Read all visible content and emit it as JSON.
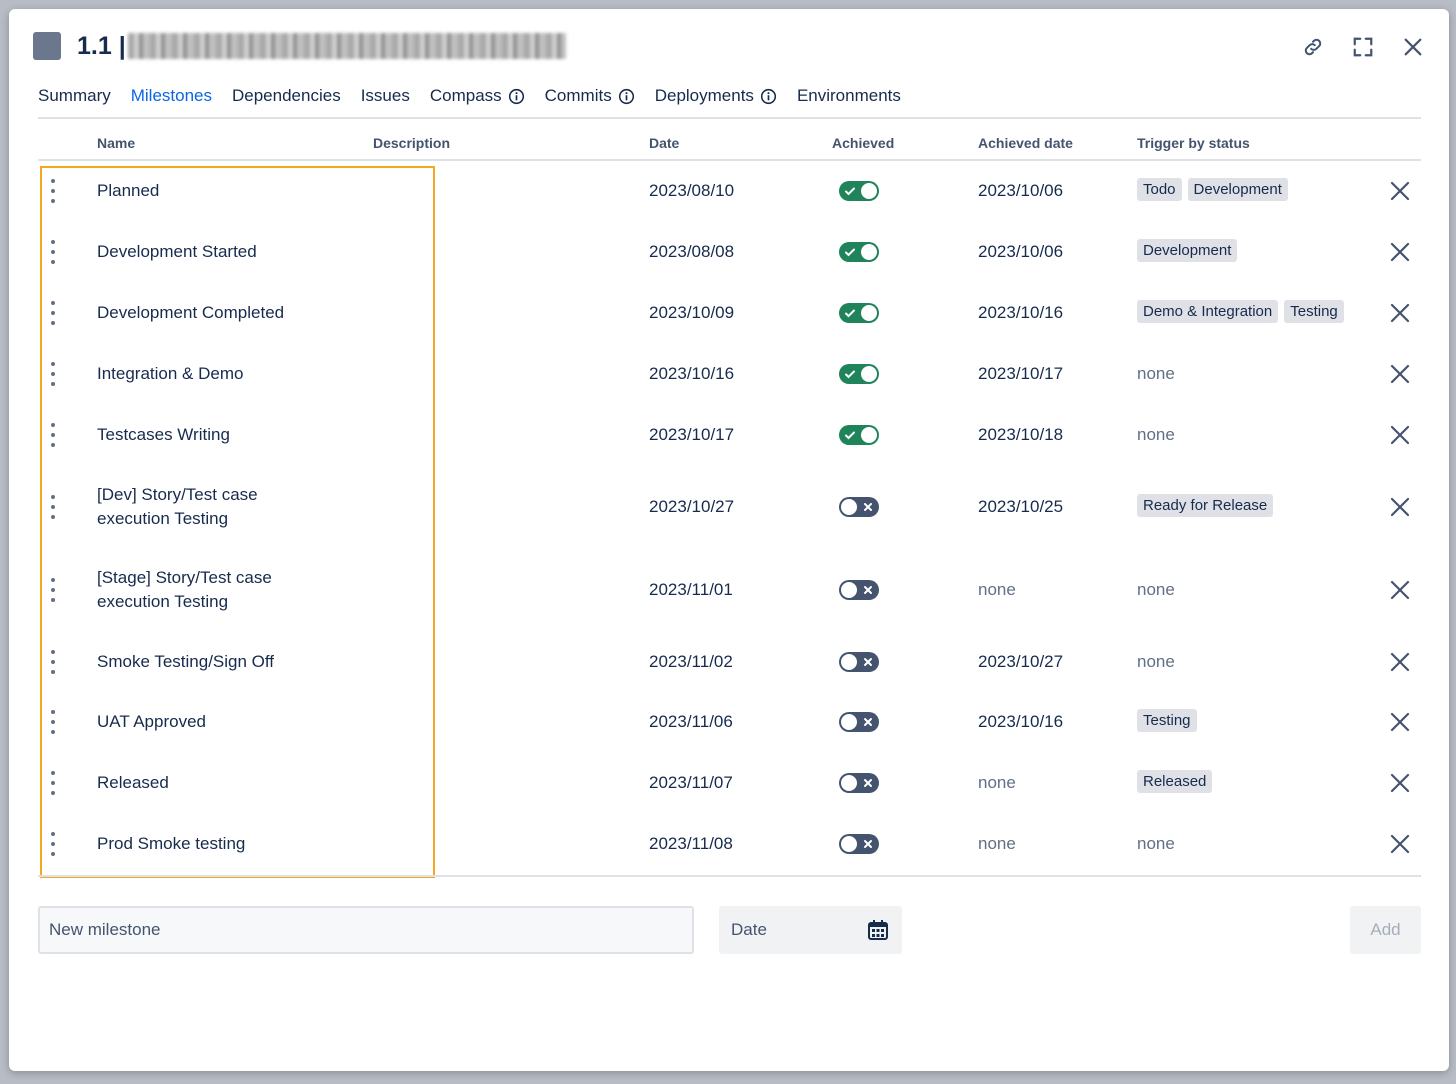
{
  "header": {
    "title_prefix": "1.1 |"
  },
  "tabs": [
    {
      "label": "Summary",
      "active": false,
      "info": false
    },
    {
      "label": "Milestones",
      "active": true,
      "info": false
    },
    {
      "label": "Dependencies",
      "active": false,
      "info": false
    },
    {
      "label": "Issues",
      "active": false,
      "info": false
    },
    {
      "label": "Compass",
      "active": false,
      "info": true
    },
    {
      "label": "Commits",
      "active": false,
      "info": true
    },
    {
      "label": "Deployments",
      "active": false,
      "info": true
    },
    {
      "label": "Environments",
      "active": false,
      "info": false
    }
  ],
  "columns": {
    "name": "Name",
    "description": "Description",
    "date": "Date",
    "achieved": "Achieved",
    "achieved_date": "Achieved date",
    "trigger": "Trigger by status"
  },
  "milestones": [
    {
      "name": [
        "Planned"
      ],
      "date": "2023/08/10",
      "achieved": true,
      "achieved_date": "2023/10/06",
      "triggers": [
        "Todo",
        "Development"
      ]
    },
    {
      "name": [
        "Development Started"
      ],
      "date": "2023/08/08",
      "achieved": true,
      "achieved_date": "2023/10/06",
      "triggers": [
        "Development"
      ]
    },
    {
      "name": [
        "Development Completed"
      ],
      "date": "2023/10/09",
      "achieved": true,
      "achieved_date": "2023/10/16",
      "triggers": [
        "Demo & Integration",
        "Testing"
      ]
    },
    {
      "name": [
        "Integration & Demo"
      ],
      "date": "2023/10/16",
      "achieved": true,
      "achieved_date": "2023/10/17",
      "triggers": []
    },
    {
      "name": [
        "Testcases Writing"
      ],
      "date": "2023/10/17",
      "achieved": true,
      "achieved_date": "2023/10/18",
      "triggers": []
    },
    {
      "name": [
        "[Dev] Story/Test case",
        "execution Testing"
      ],
      "date": "2023/10/27",
      "achieved": false,
      "achieved_date": "2023/10/25",
      "triggers": [
        "Ready for Release"
      ]
    },
    {
      "name": [
        "[Stage] Story/Test case",
        "execution Testing"
      ],
      "date": "2023/11/01",
      "achieved": false,
      "achieved_date": "none",
      "triggers": []
    },
    {
      "name": [
        "Smoke Testing/Sign Off"
      ],
      "date": "2023/11/02",
      "achieved": false,
      "achieved_date": "2023/10/27",
      "triggers": []
    },
    {
      "name": [
        "UAT Approved"
      ],
      "date": "2023/11/06",
      "achieved": false,
      "achieved_date": "2023/10/16",
      "triggers": [
        "Testing"
      ]
    },
    {
      "name": [
        "Released"
      ],
      "date": "2023/11/07",
      "achieved": false,
      "achieved_date": "none",
      "triggers": [
        "Released"
      ]
    },
    {
      "name": [
        "Prod Smoke testing"
      ],
      "date": "2023/11/08",
      "achieved": false,
      "achieved_date": "none",
      "triggers": []
    }
  ],
  "none_label": "none",
  "footer": {
    "new_milestone_placeholder": "New milestone",
    "date_placeholder": "Date",
    "add_label": "Add"
  },
  "colors": {
    "accent": "#0c66e4",
    "toggle_on": "#1f845a",
    "toggle_off": "#44546f",
    "highlight": "#f5a623"
  }
}
